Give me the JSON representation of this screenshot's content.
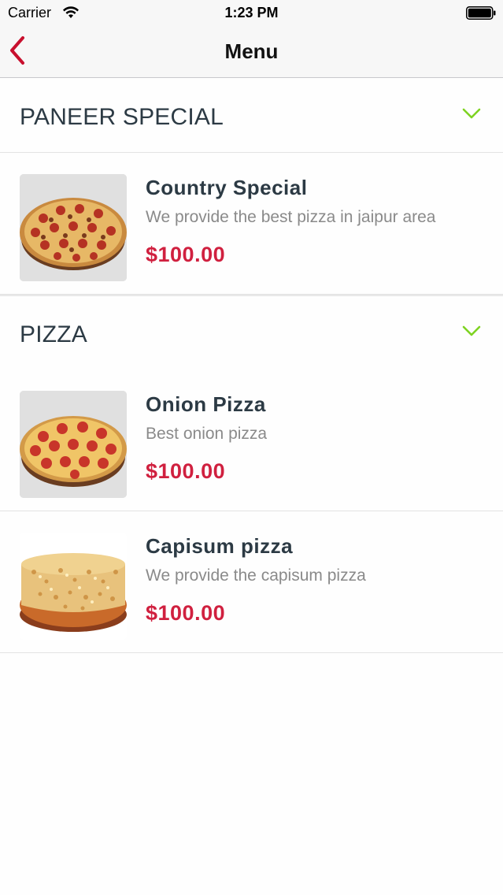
{
  "status_bar": {
    "carrier": "Carrier",
    "time": "1:23 PM"
  },
  "nav": {
    "title": "Menu",
    "back_icon": "chevron-left-icon"
  },
  "colors": {
    "accent": "#d0203f",
    "chevron": "#7ed321",
    "back": "#c8102e"
  },
  "sections": [
    {
      "title": "PANEER SPECIAL",
      "items": [
        {
          "name": "Country Special",
          "description": "We provide the best pizza in jaipur area",
          "price": "$100.00"
        }
      ]
    },
    {
      "title": "PIZZA",
      "items": [
        {
          "name": "Onion Pizza",
          "description": "Best onion pizza",
          "price": "$100.00"
        },
        {
          "name": "Capisum pizza",
          "description": "We provide the capisum pizza",
          "price": "$100.00"
        }
      ]
    }
  ]
}
